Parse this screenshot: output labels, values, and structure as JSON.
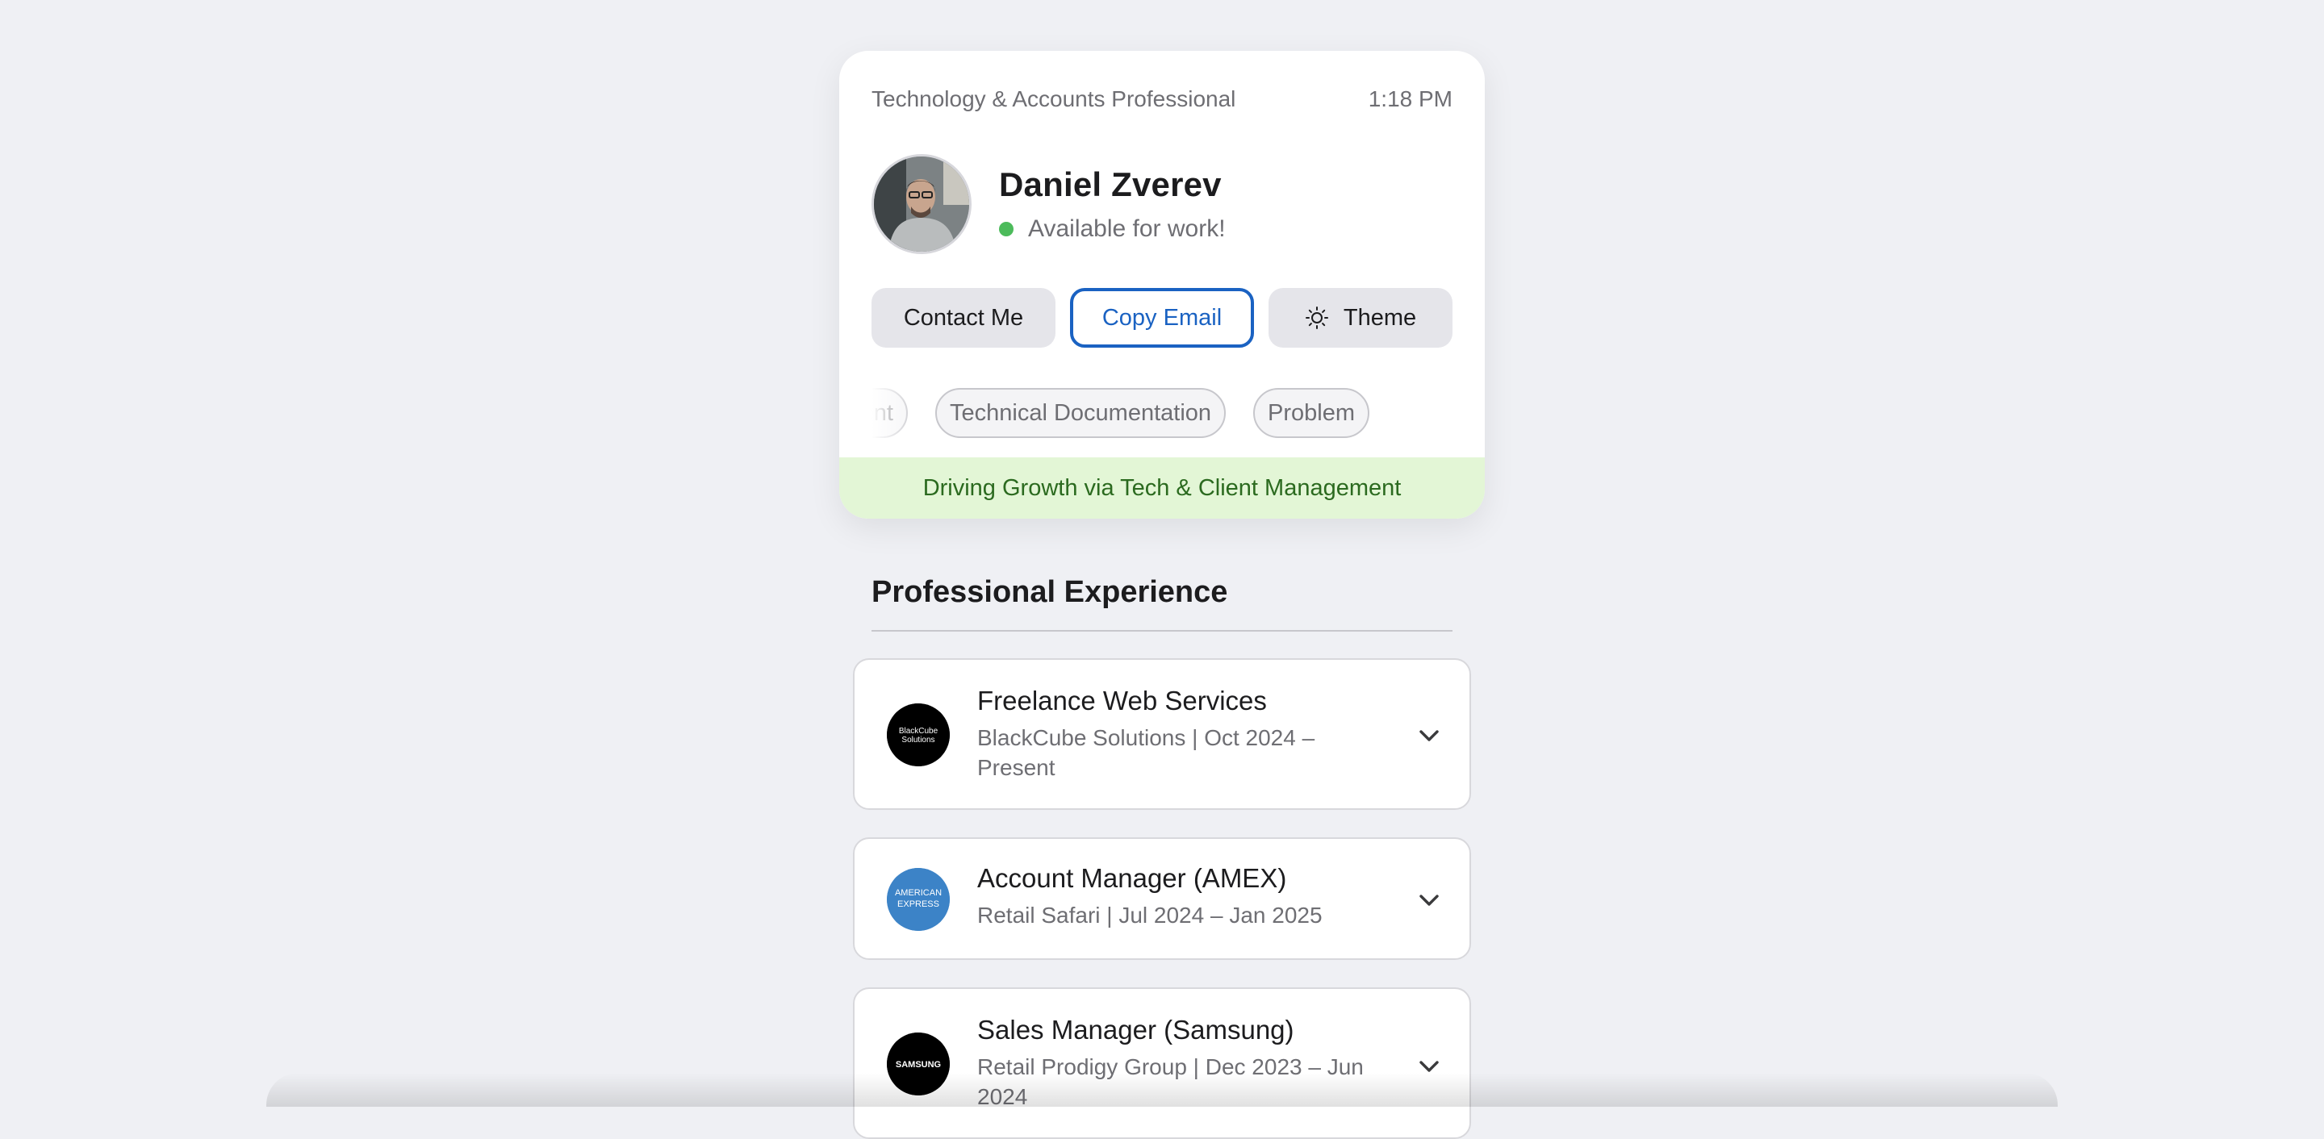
{
  "profile": {
    "role": "Technology & Accounts Professional",
    "time": "1:18 PM",
    "name": "Daniel Zverev",
    "status": "Available for work!",
    "avatar_icon": "person-photo"
  },
  "actions": {
    "contact": "Contact Me",
    "copy_email": "Copy Email",
    "theme": "Theme",
    "theme_icon": "sun-icon"
  },
  "tags": [
    "nagement",
    "Technical Documentation",
    "Problem"
  ],
  "tagline": "Driving Growth via Tech & Client Management",
  "experience": {
    "title": "Professional Experience",
    "items": [
      {
        "title": "Freelance Web Services",
        "subtitle": "BlackCube Solutions | Oct 2024 – Present",
        "logo_text": "BlackCube Solutions"
      },
      {
        "title": "Account Manager (AMEX)",
        "subtitle": "Retail Safari | Jul 2024 – Jan 2025",
        "logo_text": "AMERICAN EXPRESS"
      },
      {
        "title": "Sales Manager (Samsung)",
        "subtitle": "Retail Prodigy Group | Dec 2023 – Jun 2024",
        "logo_text": "SAMSUNG"
      }
    ]
  },
  "colors": {
    "accent_blue": "#1a62c2",
    "status_green": "#4cbb5b",
    "tagline_bg": "#e3f6d6",
    "tagline_text": "#2b6a1f",
    "amex_blue": "#3c83c7"
  }
}
